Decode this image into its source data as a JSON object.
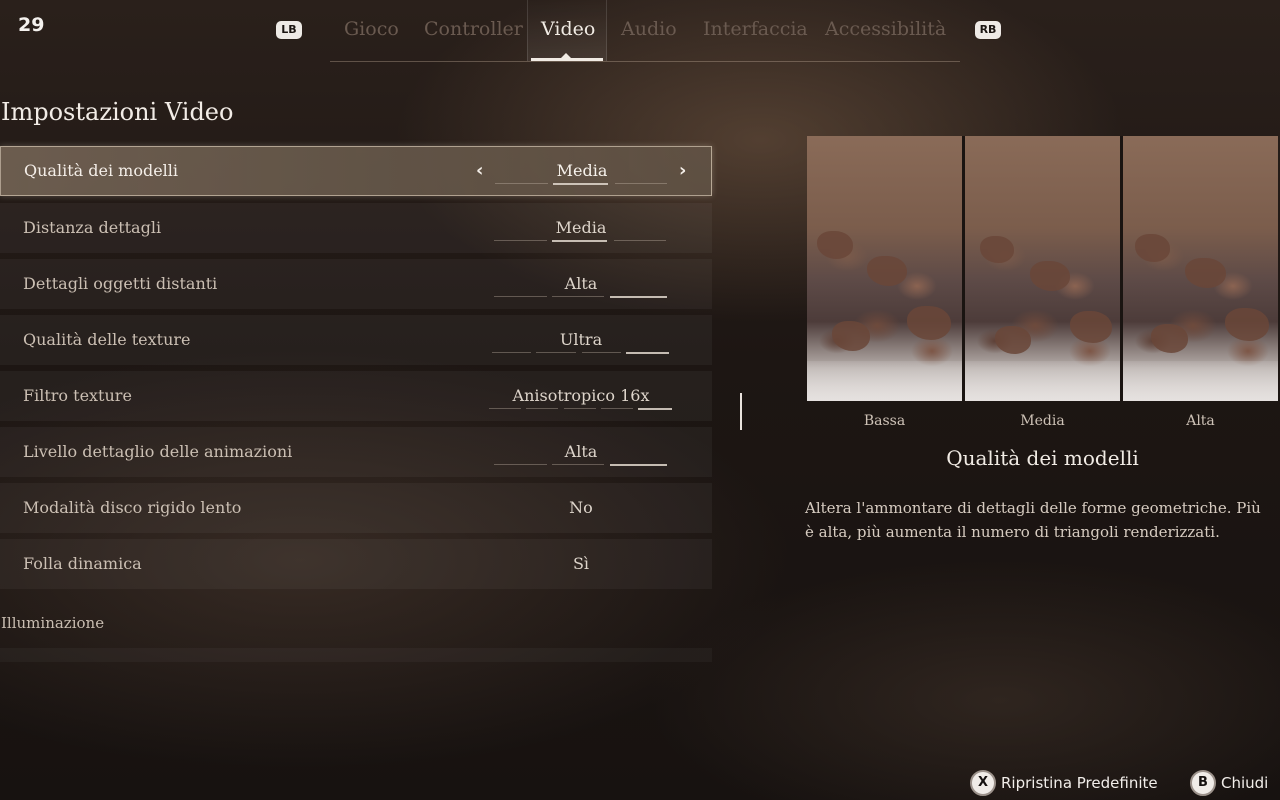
{
  "fps": "29",
  "nav": {
    "lb": "LB",
    "rb": "RB",
    "tabs": [
      {
        "label": "Gioco"
      },
      {
        "label": "Controller"
      },
      {
        "label": "Video"
      },
      {
        "label": "Audio"
      },
      {
        "label": "Interfaccia"
      },
      {
        "label": "Accessibilità"
      }
    ],
    "active_tab": "Video"
  },
  "section_title": "Impostazioni Video",
  "settings": [
    {
      "label": "Qualità dei modelli",
      "value": "Media"
    },
    {
      "label": "Distanza dettagli",
      "value": "Media"
    },
    {
      "label": "Dettagli oggetti distanti",
      "value": "Alta"
    },
    {
      "label": "Qualità delle texture",
      "value": "Ultra"
    },
    {
      "label": "Filtro texture",
      "value": "Anisotropico 16x"
    },
    {
      "label": "Livello dettaglio delle animazioni",
      "value": "Alta"
    },
    {
      "label": "Modalità disco rigido lento",
      "value": "No"
    },
    {
      "label": "Folla dinamica",
      "value": "Sì"
    }
  ],
  "subheader": "Illuminazione",
  "preview": {
    "labels": [
      "Bassa",
      "Media",
      "Alta"
    ],
    "title": "Qualità dei modelli",
    "description": "Altera l'ammontare di dettagli delle forme geometriche. Più è alta, più aumenta il numero di triangoli renderizzati."
  },
  "footer": {
    "restore_button": "X",
    "restore_label": "Ripristina Predefinite",
    "close_button": "B",
    "close_label": "Chiudi"
  },
  "colors": {
    "accent": "#f1ebe4",
    "inactive_tab": "#6a5a50",
    "selected_row": "#786858"
  }
}
